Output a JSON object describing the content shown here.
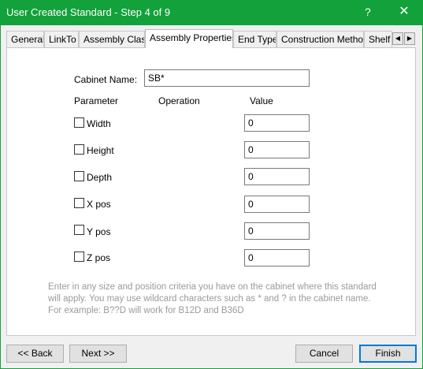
{
  "window": {
    "title": "User Created Standard - Step 4 of 9",
    "help_glyph": "?",
    "close_glyph": "✕",
    "accent": "#12a13a"
  },
  "tabs": [
    {
      "label": "General"
    },
    {
      "label": "LinkTo"
    },
    {
      "label": "Assembly Class"
    },
    {
      "label": "Assembly Properties",
      "active": true
    },
    {
      "label": "End Type"
    },
    {
      "label": "Construction Method"
    },
    {
      "label": "Shelf"
    }
  ],
  "tab_scroll": {
    "left": "◀",
    "right": "▶"
  },
  "form": {
    "cabinet_name_label": "Cabinet Name:",
    "cabinet_name_value": "SB*",
    "header_parameter": "Parameter",
    "header_operation": "Operation",
    "header_value": "Value",
    "params": [
      {
        "label": "Width",
        "value": "0",
        "checked": false
      },
      {
        "label": "Height",
        "value": "0",
        "checked": false
      },
      {
        "label": "Depth",
        "value": "0",
        "checked": false
      },
      {
        "label": "X pos",
        "value": "0",
        "checked": false
      },
      {
        "label": "Y pos",
        "value": "0",
        "checked": false
      },
      {
        "label": "Z pos",
        "value": "0",
        "checked": false
      }
    ],
    "hint": "Enter in any size and position criteria you have on the cabinet where this standard will apply.  You may use wildcard characters such as * and ? in the cabinet name.   For example: B??D will work for B12D and B36D"
  },
  "buttons": {
    "back": "<< Back",
    "next": "Next >>",
    "cancel": "Cancel",
    "finish": "Finish"
  }
}
